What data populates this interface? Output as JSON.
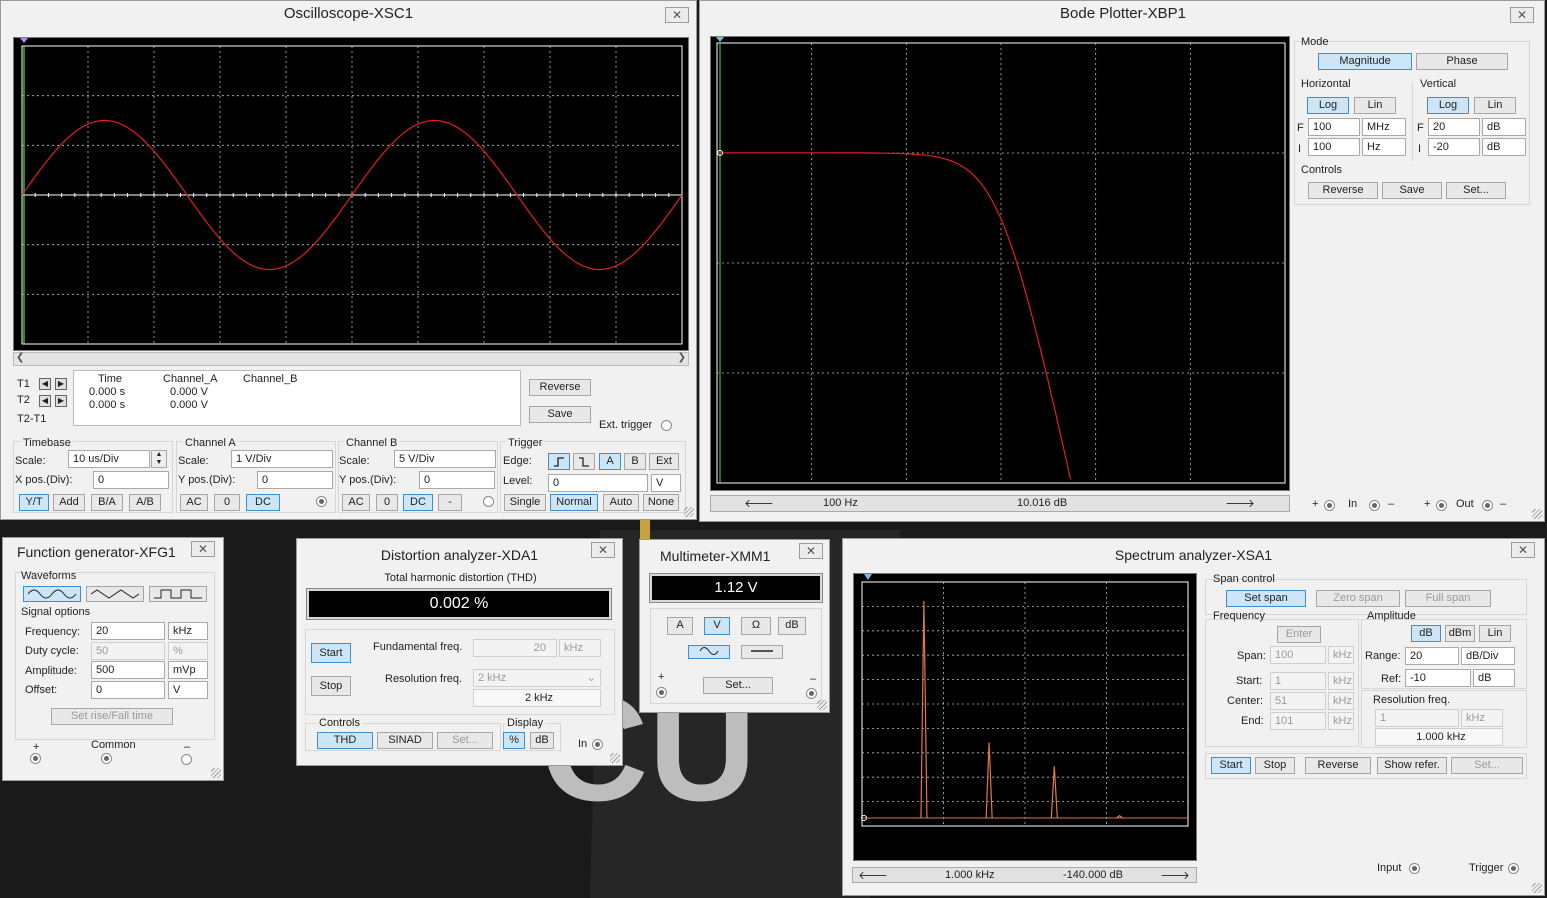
{
  "osc": {
    "title": "Oscilloscope-XSC1",
    "cursor_headers": [
      "Time",
      "Channel_A",
      "Channel_B"
    ],
    "t1_label": "T1",
    "t2_label": "T2",
    "t2t1_label": "T2-T1",
    "t1_time": "0.000 s",
    "t1_a": "0.000 V",
    "t2_time": "0.000 s",
    "t2_a": "0.000 V",
    "reverse": "Reverse",
    "save": "Save",
    "ext_trigger": "Ext. trigger",
    "timebase": {
      "label": "Timebase",
      "scale_label": "Scale:",
      "scale": "10 us/Div",
      "xpos_label": "X pos.(Div):",
      "xpos": "0",
      "yt": "Y/T",
      "add": "Add",
      "ba": "B/A",
      "ab": "A/B"
    },
    "cha": {
      "label": "Channel A",
      "scale_label": "Scale:",
      "scale": "1  V/Div",
      "ypos_label": "Y pos.(Div):",
      "ypos": "0",
      "ac": "AC",
      "zero": "0",
      "dc": "DC"
    },
    "chb": {
      "label": "Channel B",
      "scale_label": "Scale:",
      "scale": "5  V/Div",
      "ypos_label": "Y pos.(Div):",
      "ypos": "0",
      "ac": "AC",
      "zero": "0",
      "dc": "DC",
      "minus": "-"
    },
    "trig": {
      "label": "Trigger",
      "edge_label": "Edge:",
      "a": "A",
      "b": "B",
      "ext": "Ext",
      "level_label": "Level:",
      "level": "0",
      "level_unit": "V",
      "single": "Single",
      "normal": "Normal",
      "auto": "Auto",
      "none": "None"
    }
  },
  "bode": {
    "title": "Bode Plotter-XBP1",
    "mode_label": "Mode",
    "magnitude": "Magnitude",
    "phase": "Phase",
    "horizontal_label": "Horizontal",
    "vertical_label": "Vertical",
    "log": "Log",
    "lin": "Lin",
    "f_label": "F",
    "i_label": "I",
    "h_f": "100",
    "h_f_unit": "MHz",
    "h_i": "100",
    "h_i_unit": "Hz",
    "v_f": "20",
    "v_f_unit": "dB",
    "v_i": "-20",
    "v_i_unit": "dB",
    "controls_label": "Controls",
    "reverse": "Reverse",
    "save": "Save",
    "set": "Set...",
    "readout_freq": "100  Hz",
    "readout_db": "10.016 dB",
    "plus": "+",
    "in": "In",
    "out": "Out",
    "minus": "–"
  },
  "fg": {
    "title": "Function generator-XFG1",
    "waveforms_label": "Waveforms",
    "signal_options_label": "Signal options",
    "frequency_label": "Frequency:",
    "frequency": "20",
    "frequency_unit": "kHz",
    "duty_label": "Duty cycle:",
    "duty": "50",
    "duty_unit": "%",
    "amplitude_label": "Amplitude:",
    "amplitude": "500",
    "amplitude_unit": "mVp",
    "offset_label": "Offset:",
    "offset": "0",
    "offset_unit": "V",
    "rise_fall": "Set rise/Fall time",
    "plus": "+",
    "common": "Common",
    "minus": "–"
  },
  "dist": {
    "title": "Distortion analyzer-XDA1",
    "thd_label": "Total harmonic distortion (THD)",
    "thd_value": "0.002 %",
    "start": "Start",
    "stop": "Stop",
    "fund_label": "Fundamental freq.",
    "fund_value": "20",
    "fund_unit": "kHz",
    "res_label": "Resolution freq.",
    "res_value": "2 kHz",
    "res_display": "2 kHz",
    "controls_label": "Controls",
    "thd": "THD",
    "sinad": "SINAD",
    "set": "Set...",
    "display_label": "Display",
    "pct": "%",
    "db": "dB",
    "in": "In"
  },
  "mm": {
    "title": "Multimeter-XMM1",
    "reading": "1.12 V",
    "a": "A",
    "v": "V",
    "ohm": "Ω",
    "db": "dB",
    "set": "Set...",
    "plus": "+",
    "minus": "–"
  },
  "spec": {
    "title": "Spectrum analyzer-XSA1",
    "span_control_label": "Span control",
    "set_span": "Set span",
    "zero_span": "Zero span",
    "full_span": "Full span",
    "frequency_label": "Frequency",
    "enter": "Enter",
    "span_label": "Span:",
    "span": "100",
    "span_unit": "kHz",
    "start_label": "Start:",
    "start": "1",
    "start_unit": "kHz",
    "center_label": "Center:",
    "center": "51",
    "center_unit": "kHz",
    "end_label": "End:",
    "end": "101",
    "end_unit": "kHz",
    "amplitude_label": "Amplitude",
    "db": "dB",
    "dbm": "dBm",
    "lin": "Lin",
    "range_label": "Range:",
    "range": "20",
    "range_unit": "dB/Div",
    "ref_label": "Ref:",
    "ref": "-10",
    "ref_unit": "dB",
    "res_label": "Resolution freq.",
    "res": "1",
    "res_unit": "kHz",
    "res_display": "1.000 kHz",
    "start_btn": "Start",
    "stop_btn": "Stop",
    "reverse": "Reverse",
    "show_ref": "Show refer.",
    "set": "Set...",
    "readout_freq": "1.000 kHz",
    "readout_db": "-140.000  dB",
    "input": "Input",
    "trigger": "Trigger"
  },
  "traces": {
    "osc_trace": {
      "color": "#e0201c",
      "amplitude_div": 1.5,
      "cycles_shown": 2.0,
      "phase_div_start": 0
    },
    "bode_trace": {
      "color": "#e0201c",
      "passband_db": 10.016,
      "corner_hz": 100000,
      "slope_db_per_decade": -40
    },
    "spectrum_peaks_khz": [
      20,
      40,
      60,
      80
    ],
    "spectrum_peak_heights": [
      0.92,
      0.32,
      0.22,
      0.01
    ],
    "spectrum_color": "#e07840"
  },
  "colors": {
    "active_button": "#cde6f7",
    "active_border": "#3c8fd0",
    "trace": "#e0201c",
    "grid": "#ffffff"
  }
}
